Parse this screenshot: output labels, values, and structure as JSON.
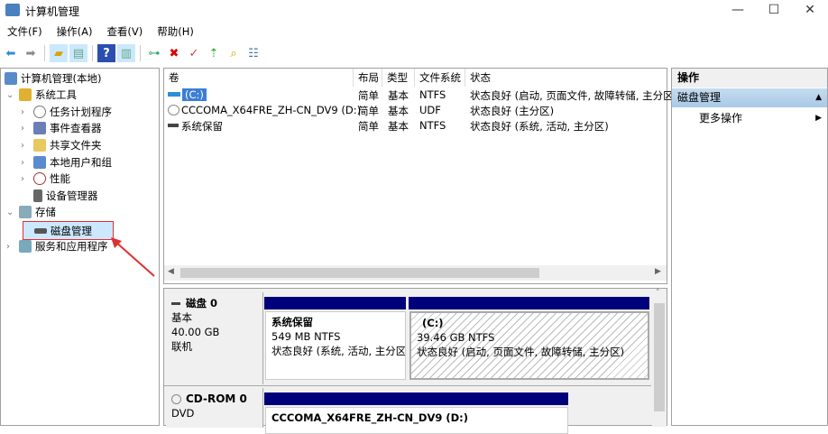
{
  "window": {
    "title": "计算机管理"
  },
  "menu": [
    "文件(F)",
    "操作(A)",
    "查看(V)",
    "帮助(H)"
  ],
  "tree": {
    "root": "计算机管理(本地)",
    "system_tools": "系统工具",
    "items": [
      "任务计划程序",
      "事件查看器",
      "共享文件夹",
      "本地用户和组",
      "性能",
      "设备管理器"
    ],
    "storage": "存储",
    "disk_mgmt": "磁盘管理",
    "services": "服务和应用程序"
  },
  "volume_table": {
    "headers": [
      "卷",
      "布局",
      "类型",
      "文件系统",
      "状态"
    ],
    "rows": [
      {
        "volume": "(C:)",
        "layout": "简单",
        "type": "基本",
        "fs": "NTFS",
        "status": "状态良好 (启动, 页面文件, 故障转储, 主分区"
      },
      {
        "volume": "CCCOMA_X64FRE_ZH-CN_DV9 (D:)",
        "layout": "简单",
        "type": "基本",
        "fs": "UDF",
        "status": "状态良好 (主分区)"
      },
      {
        "volume": "系统保留",
        "layout": "简单",
        "type": "基本",
        "fs": "NTFS",
        "status": "状态良好 (系统, 活动, 主分区)"
      }
    ]
  },
  "disks": [
    {
      "name": "磁盘 0",
      "type": "基本",
      "size": "40.00 GB",
      "state": "联机",
      "partitions": [
        {
          "name": "系统保留",
          "size": "549 MB NTFS",
          "status": "状态良好 (系统, 活动, 主分区"
        },
        {
          "name": "(C:)",
          "size": "39.46 GB NTFS",
          "status": "状态良好 (启动, 页面文件, 故障转储, 主分区)"
        }
      ]
    },
    {
      "name": "CD-ROM 0",
      "type": "DVD",
      "partitions": [
        {
          "name": "CCCOMA_X64FRE_ZH-CN_DV9  (D:)"
        }
      ]
    }
  ],
  "actions": {
    "header": "操作",
    "section": "磁盘管理",
    "more": "更多操作"
  },
  "colors": {
    "partition_bar": "#00007b",
    "selected": "#cce8ff",
    "highlight_box": "#e03030"
  }
}
